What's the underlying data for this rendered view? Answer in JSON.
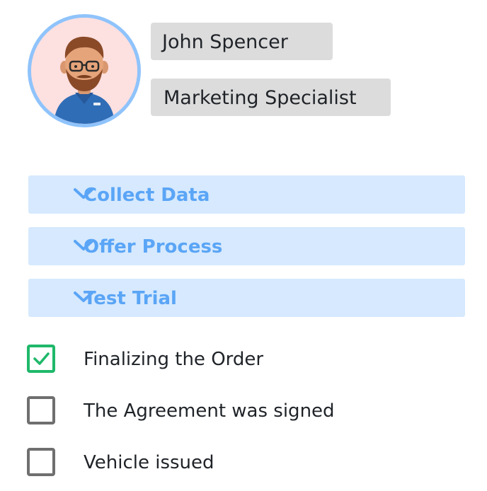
{
  "profile": {
    "name": "John Spencer",
    "role": "Marketing Specialist"
  },
  "sections": [
    {
      "label": "Collect Data",
      "icon": "chevron-down-icon"
    },
    {
      "label": "Offer Process",
      "icon": "chevron-down-icon"
    },
    {
      "label": "Test Trial",
      "icon": "chevron-down-icon"
    }
  ],
  "checklist": [
    {
      "label": "Finalizing the Order",
      "checked": true
    },
    {
      "label": "The Agreement was signed",
      "checked": false
    },
    {
      "label": "Vehicle issued",
      "checked": false
    }
  ],
  "colors": {
    "accent": "#5aa5f6",
    "section_bg": "#d6e9fe",
    "check_green": "#1fb86a",
    "avatar_ring": "#8fc3fb"
  }
}
